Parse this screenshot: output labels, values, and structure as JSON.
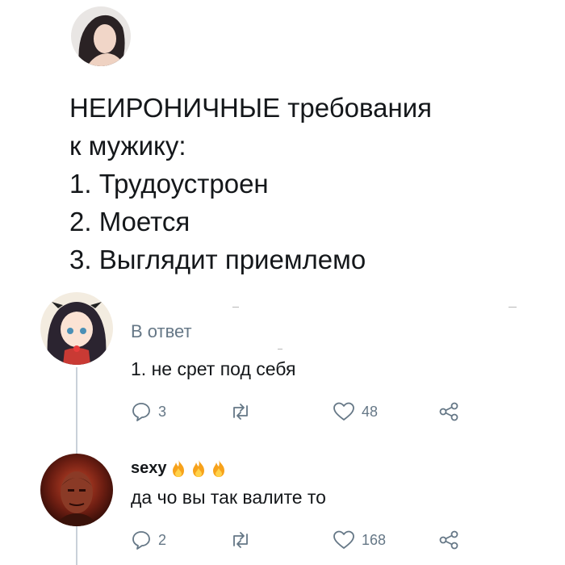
{
  "tweet": {
    "lines": [
      "НЕИРОНИЧНЫЕ требования",
      "к мужику:",
      "1. Трудоустроен",
      "2. Моется",
      "3. Выглядит приемлемо"
    ]
  },
  "replies": [
    {
      "reply_to_label": "В ответ",
      "text": "1. не срет под себя",
      "counts": {
        "replies": "3",
        "retweets": "",
        "likes": "48"
      }
    },
    {
      "username": "sexy",
      "username_emoji": [
        "fire-icon",
        "fire-icon",
        "fire-icon"
      ],
      "text": "да чо вы так валите то",
      "counts": {
        "replies": "2",
        "retweets": "",
        "likes": "168"
      }
    }
  ],
  "colors": {
    "text": "#14171a",
    "secondary": "#657786",
    "thread_line": "#c9d1d9",
    "fire": "#f7a21b"
  }
}
